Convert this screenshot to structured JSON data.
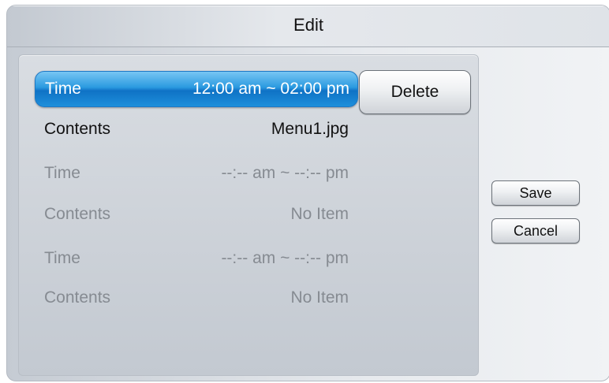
{
  "dialog": {
    "title": "Edit"
  },
  "entries": [
    {
      "time_label": "Time",
      "time_value": "12:00 am ~ 02:00 pm",
      "contents_label": "Contents",
      "contents_value": "Menu1.jpg"
    },
    {
      "time_label": "Time",
      "time_value": "--:-- am ~ --:-- pm",
      "contents_label": "Contents",
      "contents_value": "No Item"
    },
    {
      "time_label": "Time",
      "time_value": "--:-- am ~ --:-- pm",
      "contents_label": "Contents",
      "contents_value": "No Item"
    }
  ],
  "buttons": {
    "delete": "Delete",
    "save": "Save",
    "cancel": "Cancel"
  },
  "colors": {
    "selection_blue": "#1e8fdb",
    "disabled_text": "#868b92"
  }
}
